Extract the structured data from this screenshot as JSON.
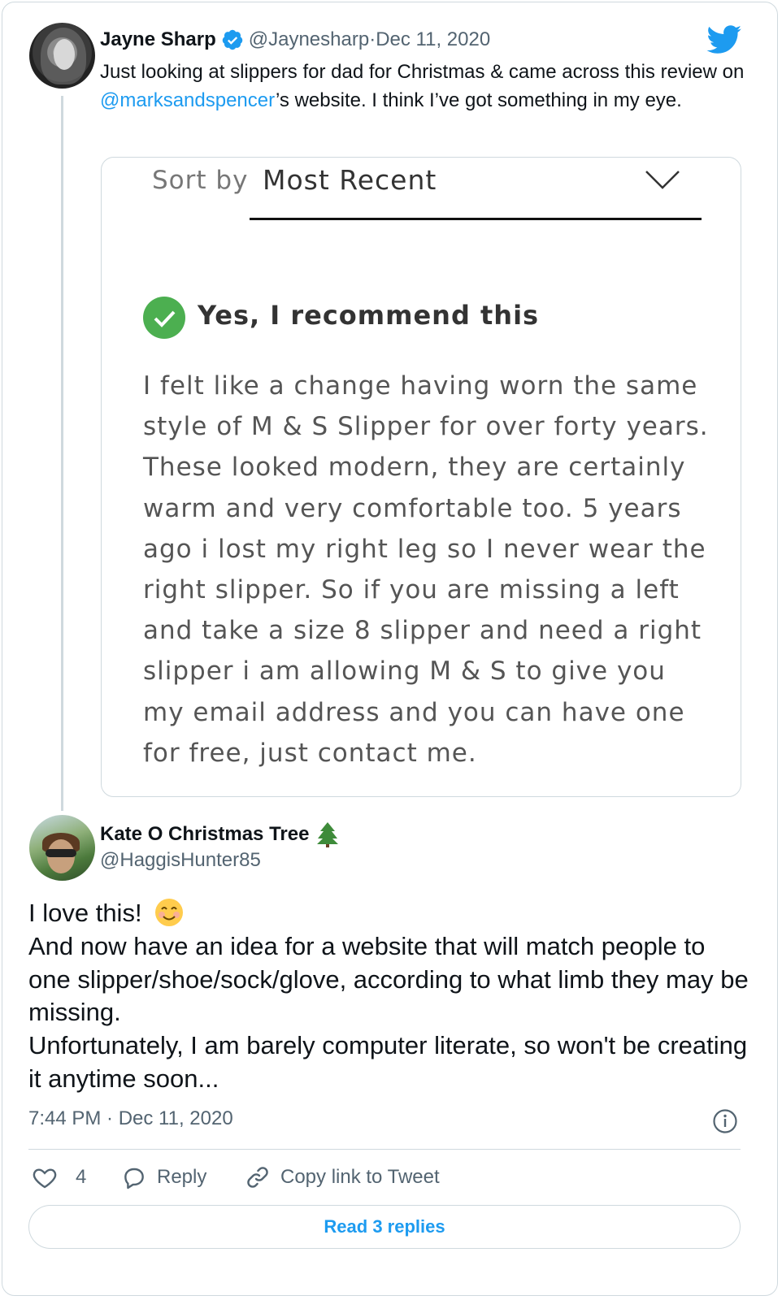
{
  "tweet": {
    "author": {
      "name": "Jayne Sharp",
      "handle": "@Jaynesharp",
      "separator": " · ",
      "date": "Dec 11, 2020"
    },
    "text_before": "Just looking at slippers for dad for Christmas & came across this review on ",
    "mention": "@marksandspencer",
    "text_after": "’s website. I think I’ve got something in my eye.",
    "media": {
      "sort_label": "Sort by",
      "sort_value": "Most Recent",
      "recommend_label": "Yes, I recommend this",
      "review_text": "I felt like a change having worn the same style of M & S Slipper for over forty years. These looked modern, they are certainly warm and very comfortable too. 5 years ago i lost my right leg so I never wear the right slipper. So if you are missing a left and take a size 8 slipper and need a right slipper i am allowing M & S to give you my email address and you can have one for free, just contact me."
    }
  },
  "reply": {
    "author": {
      "name": "Kate O Christmas Tree",
      "handle": "@HaggisHunter85"
    },
    "line1": "I love this!",
    "body": "And now have an idea for a website that will match people to one slipper/shoe/sock/glove, according to what limb they may be missing.\nUnfortunately, I am barely computer literate, so won't be creating it anytime soon...",
    "timestamp": "7:44 PM · Dec 11, 2020"
  },
  "actions": {
    "like_count": "4",
    "reply_label": "Reply",
    "copy_label": "Copy link to Tweet",
    "read_replies_label": "Read 3 replies"
  },
  "icons": {
    "verified": "verified-badge-icon",
    "twitter": "twitter-bird-icon",
    "check": "check-circle-icon",
    "chevron": "chevron-down-icon",
    "tree": "christmas-tree-emoji",
    "smile": "smiling-face-emoji",
    "info": "info-icon",
    "like": "heart-icon",
    "reply": "reply-bubble-icon",
    "link": "link-icon"
  },
  "colors": {
    "accent": "#1d9bf0",
    "text": "#0f1419",
    "secondary": "#536471",
    "border": "#cfd9de",
    "check_green": "#4caf50"
  }
}
